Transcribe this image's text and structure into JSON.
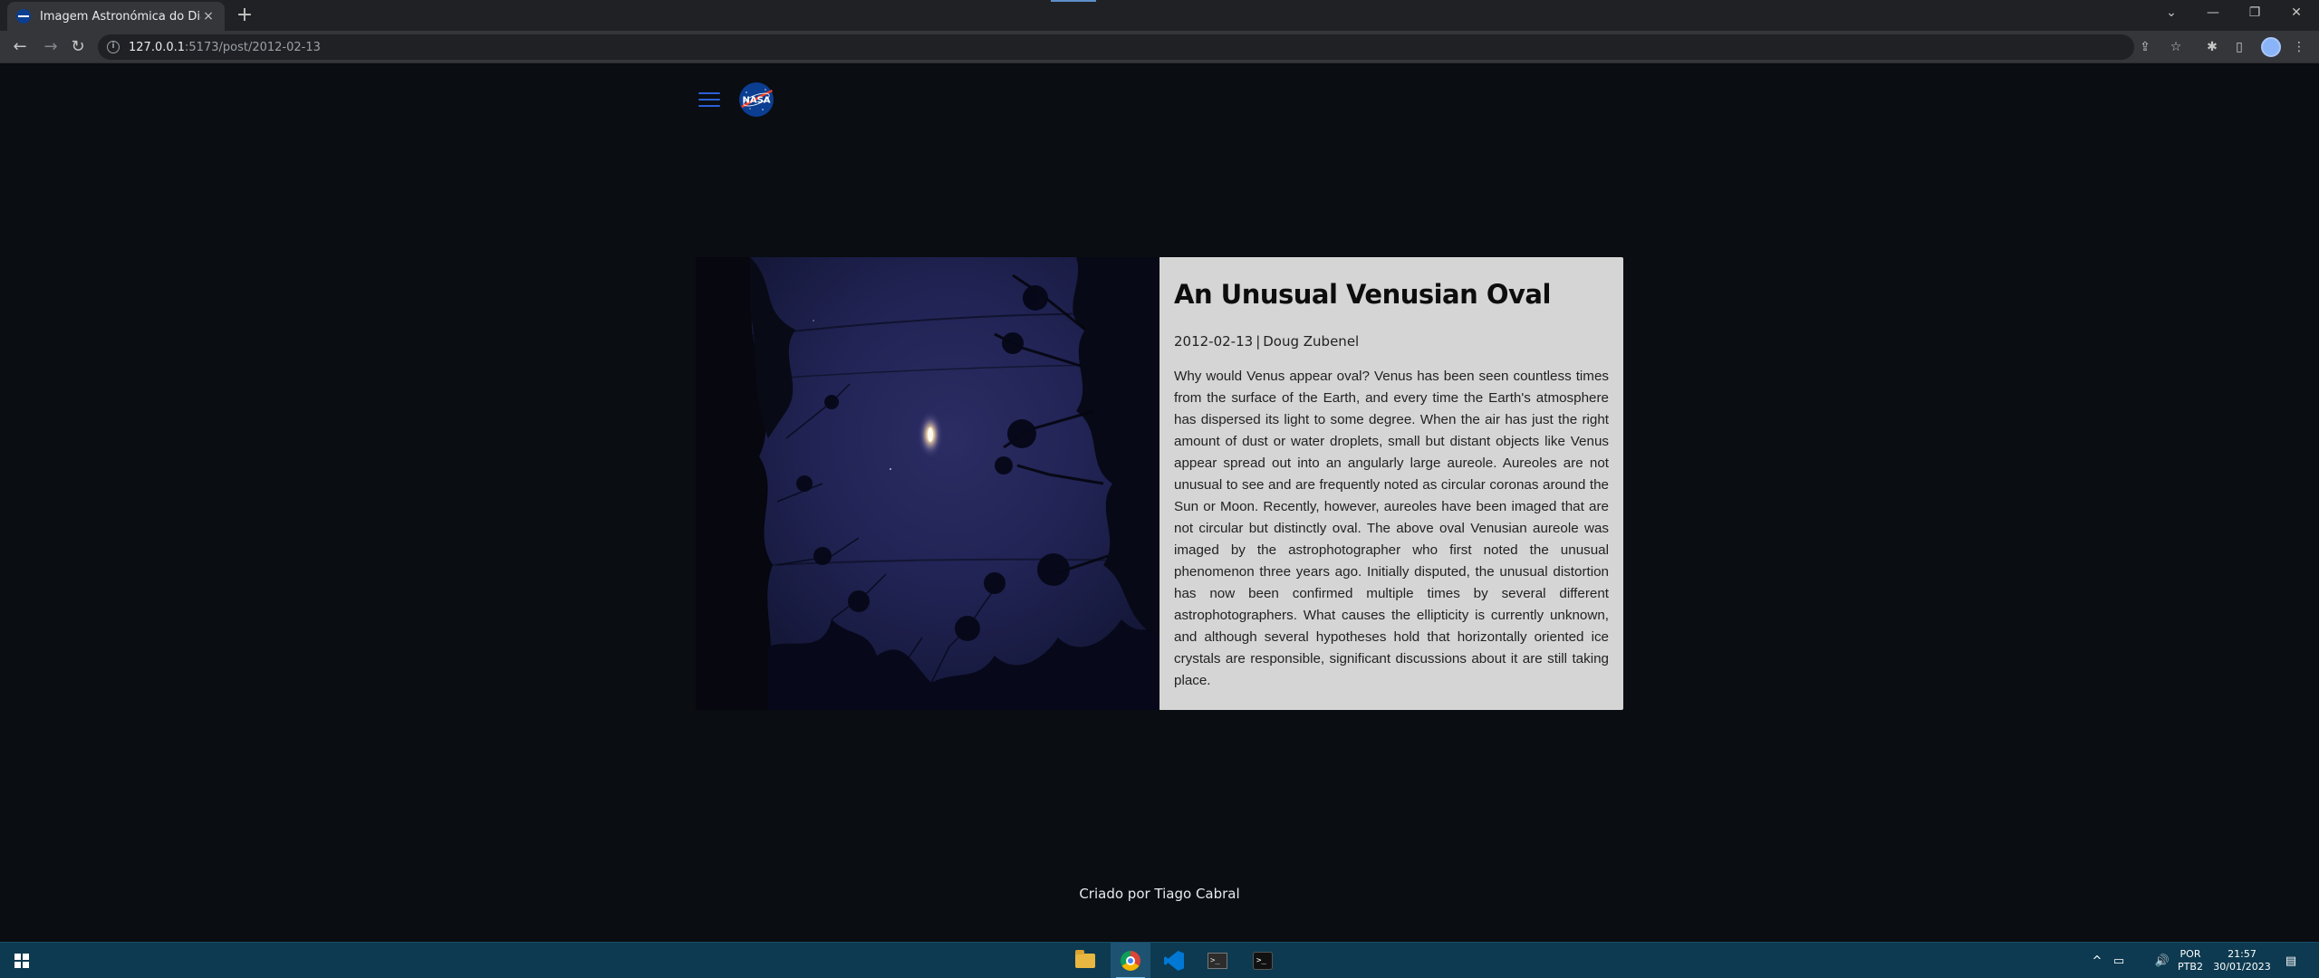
{
  "browser": {
    "tab_title": "Imagem Astronómica do Dia",
    "url_host": "127.0.0.1",
    "url_path": ":5173/post/2012-02-13"
  },
  "icons": {
    "tab_close": "×",
    "new_tab": "+",
    "tab_search": "⌄",
    "minimize": "—",
    "restore": "❐",
    "close_window": "✕",
    "back": "←",
    "forward": "→",
    "reload": "↻",
    "site_info": "i",
    "share": "⇪",
    "bookmark": "☆",
    "extensions": "✱",
    "side_panel": "▯",
    "menu": "⋮",
    "terminal_prompt": ">_",
    "terminal2_prompt": ">_",
    "tray_chevron": "^",
    "tray_network": "▭",
    "tray_volume": "🔊",
    "notifications": "▤"
  },
  "header": {
    "logo_text": "NASA"
  },
  "post": {
    "title": "An Unusual Venusian Oval",
    "date": "2012-02-13",
    "separator": "|",
    "author": "Doug Zubenel",
    "explanation": "Why would Venus appear oval? Venus has been seen countless times from the surface of the Earth, and every time the Earth's atmosphere has dispersed its light to some degree. When the air has just the right amount of dust or water droplets, small but distant objects like Venus appear spread out into an angularly large aureole. Aureoles are not unusual to see and are frequently noted as circular coronas around the Sun or Moon. Recently, however, aureoles have been imaged that are not circular but distinctly oval. The above oval Venusian aureole was imaged by the astrophotographer who first noted the unusual phenomenon three years ago. Initially disputed, the unusual distortion has now been confirmed multiple times by several different astrophotographers. What causes the ellipticity is currently unknown, and although several hypotheses hold that horizontally oriented ice crystals are responsible, significant discussions about it are still taking place."
  },
  "footer": {
    "credit": "Criado por Tiago Cabral"
  },
  "taskbar": {
    "language_line1": "POR",
    "language_line2": "PTB2",
    "time": "21:57",
    "date": "30/01/2023"
  },
  "colors": {
    "page_bg": "#0a0d11",
    "card_text_bg": "#d5d5d5",
    "hamburger": "#2b5fd9",
    "taskbar": "#0d3a50"
  }
}
